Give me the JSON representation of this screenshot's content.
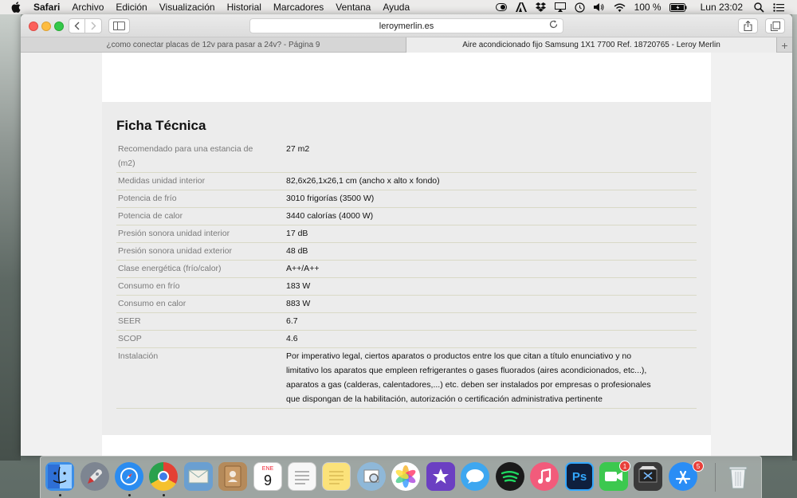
{
  "menubar": {
    "app": "Safari",
    "items": [
      "Archivo",
      "Edición",
      "Visualización",
      "Historial",
      "Marcadores",
      "Ventana",
      "Ayuda"
    ],
    "battery": "100 %",
    "clock": "Lun 23:02"
  },
  "browser": {
    "url": "leroymerlin.es",
    "tabs": [
      "¿como conectar placas de 12v para pasar a 24v? - Página 9",
      "Aire acondicionado fijo Samsung 1X1 7700 Ref. 18720765 - Leroy Merlin"
    ],
    "new_tab": "+"
  },
  "page": {
    "heading": "Ficha Técnica",
    "specs": [
      {
        "key": "Recomendado para una estancia de (m2)",
        "value": "27 m2"
      },
      {
        "key": "Medidas unidad interior",
        "value": "82,6x26,1x26,1 cm (ancho x alto x fondo)"
      },
      {
        "key": "Potencia de frío",
        "value": "3010 frigorías (3500 W)"
      },
      {
        "key": "Potencia de calor",
        "value": "3440 calorías (4000 W)"
      },
      {
        "key": "Presión sonora unidad interior",
        "value": "17 dB"
      },
      {
        "key": "Presión sonora unidad exterior",
        "value": "48 dB"
      },
      {
        "key": "Clase energética (frío/calor)",
        "value": "A++/A++"
      },
      {
        "key": "Consumo en frío",
        "value": "183 W"
      },
      {
        "key": "Consumo en calor",
        "value": "883 W"
      },
      {
        "key": "SEER",
        "value": "6.7"
      },
      {
        "key": "SCOP",
        "value": "4.6"
      },
      {
        "key": "Instalación",
        "value": "Por imperativo legal, ciertos aparatos o productos entre los que citan a título enunciativo y no limitativo los aparatos que empleen refrigerantes o gases fluorados (aires acondicionados, etc...), aparatos a gas (calderas, calentadores,...) etc. deben ser instalados por empresas o profesionales que dispongan de la habilitación, autorización o certificación administrativa pertinente"
      }
    ]
  },
  "dock": {
    "icons": [
      {
        "name": "finder",
        "color": "#3d8ee6"
      },
      {
        "name": "launchpad",
        "color": "#7d8591"
      },
      {
        "name": "safari",
        "color": "#2b8cf0"
      },
      {
        "name": "chrome",
        "color": "#e44134"
      },
      {
        "name": "mail",
        "color": "#6a9fd1"
      },
      {
        "name": "contacts",
        "color": "#b58a5a"
      },
      {
        "name": "calendar",
        "color": "#ffffff"
      },
      {
        "name": "reminders",
        "color": "#f7f7f7"
      },
      {
        "name": "notes",
        "color": "#fbe27a"
      },
      {
        "name": "preview",
        "color": "#8fb8d8"
      },
      {
        "name": "photos",
        "color": "#ffffff"
      },
      {
        "name": "imovie",
        "color": "#6b3fc2"
      },
      {
        "name": "messages",
        "color": "#3ea7f0"
      },
      {
        "name": "spotify",
        "color": "#1a1a1a"
      },
      {
        "name": "itunes",
        "color": "#f25b7b"
      },
      {
        "name": "photoshop",
        "color": "#0f1f3d"
      },
      {
        "name": "facetime",
        "color": "#3cc84f"
      },
      {
        "name": "final-cut",
        "color": "#3a3a3a"
      },
      {
        "name": "app-store",
        "color": "#2a8df5"
      },
      {
        "name": "trash",
        "color": "#cfd3d6"
      }
    ],
    "calendar_month": "ENE",
    "calendar_day": "9",
    "photoshop_label": "Ps",
    "facetime_badge": "1",
    "appstore_badge": "5"
  },
  "colors": {
    "accent_red": "#fc605b",
    "accent_yellow": "#fdbc40",
    "accent_green": "#34c84a"
  }
}
